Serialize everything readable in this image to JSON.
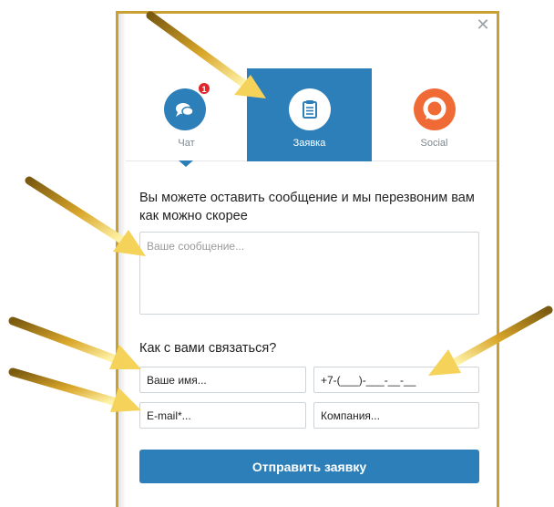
{
  "tabs": [
    {
      "id": "chat",
      "label": "Чат",
      "icon": "chat-bubbles-icon",
      "badge": "1",
      "active": false
    },
    {
      "id": "request",
      "label": "Заявка",
      "icon": "clipboard-icon",
      "active": true
    },
    {
      "id": "social",
      "label": "Social",
      "icon": "social-ring-icon",
      "active": false
    }
  ],
  "form": {
    "intro": "Вы можете оставить сообщение и мы перезвоним вам как можно скорее",
    "message_placeholder": "Ваше сообщение...",
    "contact_label": "Как с вами связаться?",
    "name_placeholder": "Ваше имя...",
    "phone_placeholder": "+7-(___)-___-__-__",
    "email_placeholder": "E-mail*...",
    "company_placeholder": "Компания...",
    "submit_label": "Отправить заявку"
  },
  "colors": {
    "accent": "#2c7fb8",
    "social": "#ef6a35",
    "badge": "#e0262b",
    "frame": "#c9a032",
    "arrow": "#e8b830"
  }
}
